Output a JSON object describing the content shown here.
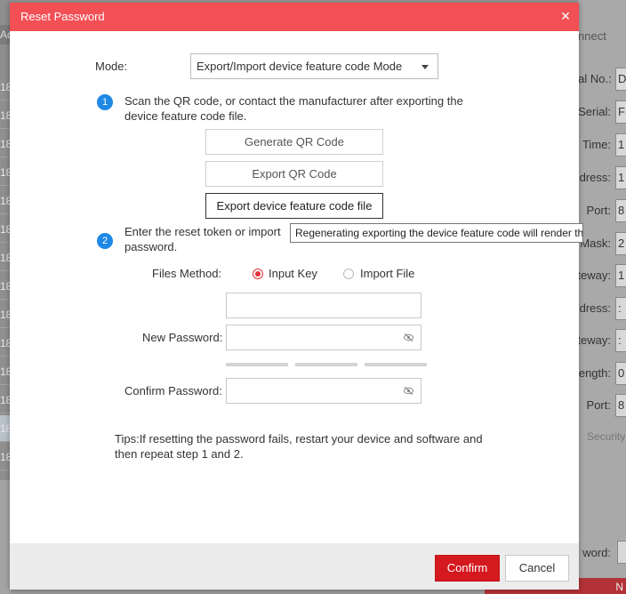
{
  "background": {
    "left_header": "Ad",
    "left_rows": [
      "18.",
      "18.",
      "18.",
      "18.",
      "18.",
      "18.",
      "18.",
      "18.",
      "18.",
      "18.",
      "18.",
      "18.",
      "18.",
      "18.",
      "18."
    ],
    "right_title": "nnect",
    "right_fields": [
      {
        "label": "Serial No.:",
        "value": "D"
      },
      {
        "label": "Serial:",
        "value": "F"
      },
      {
        "label": "Time:",
        "value": "1"
      },
      {
        "label": "ddress:",
        "value": "1"
      },
      {
        "label": "Port:",
        "value": "8"
      },
      {
        "label": "Mask:",
        "value": "2"
      },
      {
        "label": "teway:",
        "value": "1"
      },
      {
        "label": "ddress:",
        "value": ":"
      },
      {
        "label": "teway:",
        "value": ":"
      },
      {
        "label": "ength:",
        "value": "0"
      },
      {
        "label": "Port:",
        "value": "8"
      }
    ],
    "security_label": "Security",
    "password_label": "word:",
    "red_button_text": "N"
  },
  "dialog": {
    "title": "Reset Password",
    "close_icon": "close-icon",
    "mode_label": "Mode:",
    "mode_value": "Export/Import device feature code Mode",
    "step1_number": "1",
    "step1_text": "Scan the QR code, or contact the manufacturer after exporting the device feature code file.",
    "btn_generate_qr": "Generate QR Code",
    "btn_export_qr": "Export QR Code",
    "btn_export_feature": "Export device feature code file",
    "tooltip": "Regenerating exporting the device feature code will render the previous",
    "step2_number": "2",
    "step2_text": "Enter the reset token or import",
    "step2_text_cont": "password.",
    "files_method_label": "Files Method:",
    "radio_input_key": "Input Key",
    "radio_import_file": "Import File",
    "selected_method": "Input Key",
    "key_value": "",
    "new_password_label": "New Password:",
    "new_password_value": "",
    "confirm_password_label": "Confirm Password:",
    "confirm_password_value": "",
    "tips": "Tips:If resetting the password fails, restart your device and software and then repeat step 1 and 2.",
    "confirm_button": "Confirm",
    "cancel_button": "Cancel",
    "accent_color": "#f25055",
    "primary_button_color": "#d4191f",
    "step_color": "#1e88e5"
  }
}
